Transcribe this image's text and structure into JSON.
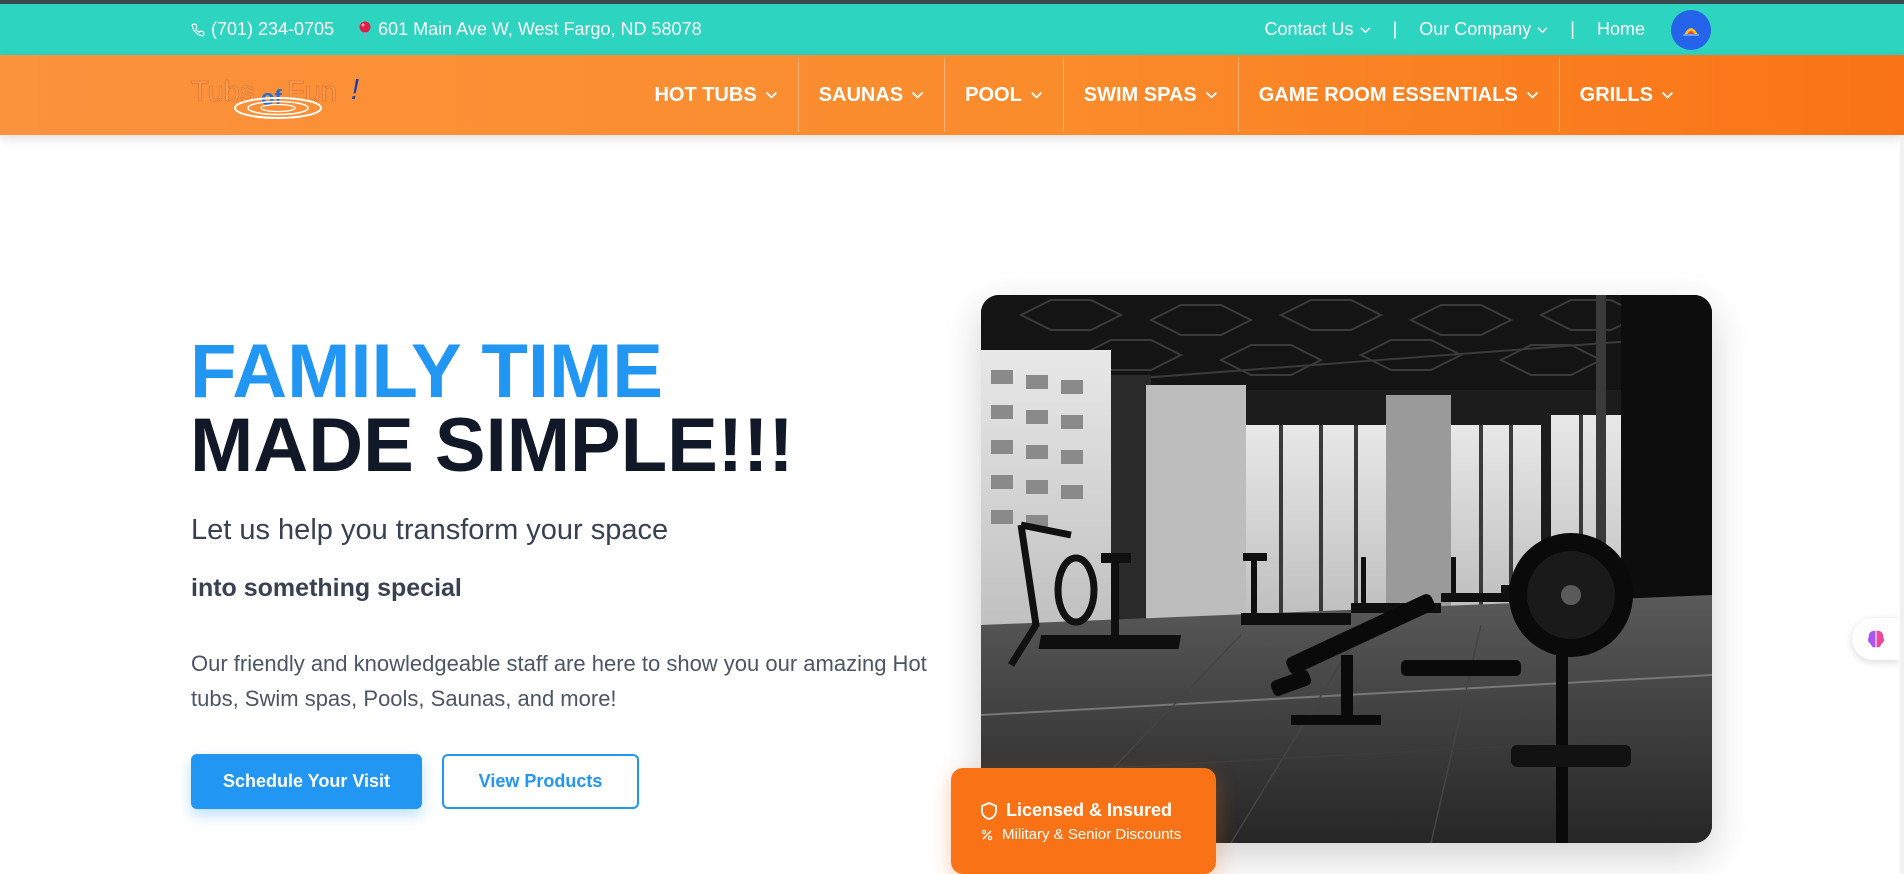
{
  "topbar": {
    "phone": "(701) 234-0705",
    "address": "601 Main Ave W, West Fargo, ND 58078",
    "links": [
      "Contact Us",
      "Our Company"
    ],
    "home": "Home",
    "separator": "|",
    "background": "#2dd4bf"
  },
  "logo": {
    "text_part1": "Tubs",
    "text_part2": "of",
    "text_part3": "Fun",
    "text_part4": "!"
  },
  "nav": {
    "items": [
      "HOT TUBS",
      "SAUNAS",
      "POOL",
      "SWIM SPAS",
      "GAME ROOM ESSENTIALS",
      "GRILLS"
    ],
    "background": "#f97316"
  },
  "hero": {
    "title_line1": "FAMILY TIME",
    "title_line2": "MADE SIMPLE!!!",
    "subtitle": "Let us help you transform your space",
    "subtitle2": "into something special",
    "description": "Our friendly and knowledgeable staff are here to show you our amazing Hot tubs, Swim spas, Pools, Saunas, and more!",
    "primary_button": "Schedule Your Visit",
    "secondary_button": "View Products",
    "accent_color": "#2196f3"
  },
  "badge": {
    "title": "Licensed & Insured",
    "subtitle": "Military & Senior Discounts",
    "title_icon": "shield-icon",
    "subtitle_icon": "percent-icon"
  },
  "icons": {
    "phone": "phone-icon",
    "location": "map-pin-icon",
    "avatar": "user-avatar",
    "side_widget": "brain-icon"
  }
}
